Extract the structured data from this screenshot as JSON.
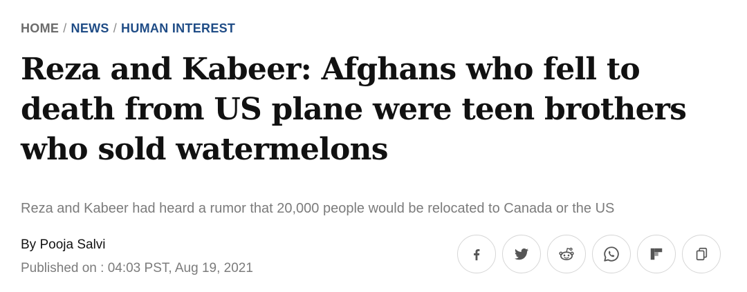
{
  "breadcrumb": {
    "home": "HOME",
    "sep1": "/",
    "news": "NEWS",
    "sep2": "/",
    "section": "HUMAN INTEREST"
  },
  "article": {
    "headline": "Reza and Kabeer: Afghans who fell to death from US plane were teen brothers who sold watermelons",
    "subhead": "Reza and Kabeer had heard a rumor that 20,000 people would be relocated to Canada or the US",
    "byline_prefix": "By",
    "author": "Pooja Salvi",
    "published": "Published on : 04:03 PST, Aug 19, 2021"
  },
  "share": {
    "icons": [
      "facebook-icon",
      "twitter-icon",
      "reddit-icon",
      "whatsapp-icon",
      "flipboard-icon",
      "copy-icon"
    ],
    "icon_color": "#555555"
  },
  "colors": {
    "link": "#1f4c86",
    "muted": "#7b7b7b"
  }
}
